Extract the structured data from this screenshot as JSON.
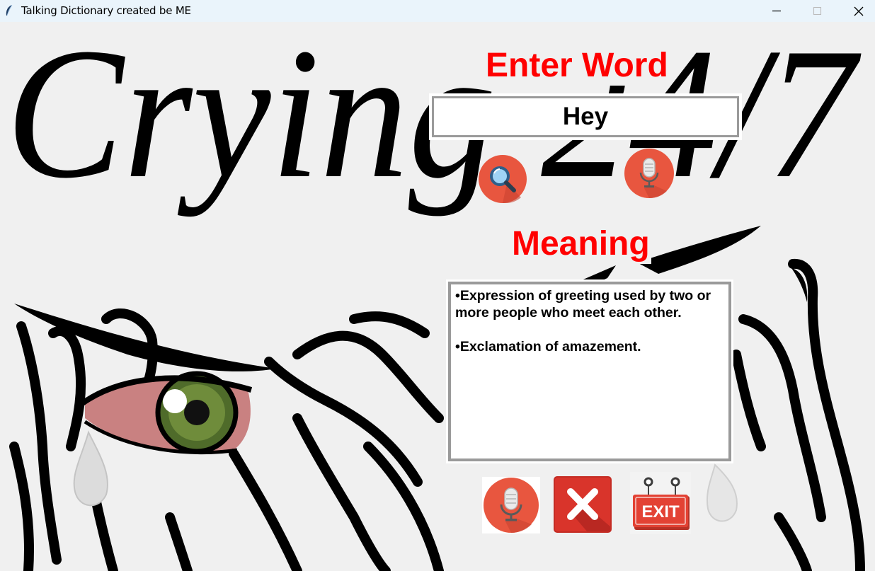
{
  "window": {
    "title": "Talking Dictionary created be ME",
    "icon": "feather-icon",
    "controls": [
      "minimize-icon",
      "maximize-icon",
      "close-icon"
    ]
  },
  "background": {
    "text": "Crying 24/7",
    "image": "crying-eye-artwork"
  },
  "enter_word": {
    "heading": "Enter Word",
    "value": "Hey"
  },
  "buttons": {
    "search": "search-icon",
    "word_mic": "microphone-icon",
    "speak_meaning": "microphone-icon",
    "clear": "close-icon",
    "exit": "EXIT"
  },
  "meaning": {
    "heading": "Meaning",
    "lines": [
      "•Expression of greeting used by two or",
      "more people who meet each other.",
      "•Exclamation of amazement."
    ]
  },
  "colors": {
    "heading": "#ff0000",
    "button": "#e8563f",
    "clear_button": "#d9342b",
    "exit_button": "#e34234",
    "background": "#f0f0f0"
  }
}
